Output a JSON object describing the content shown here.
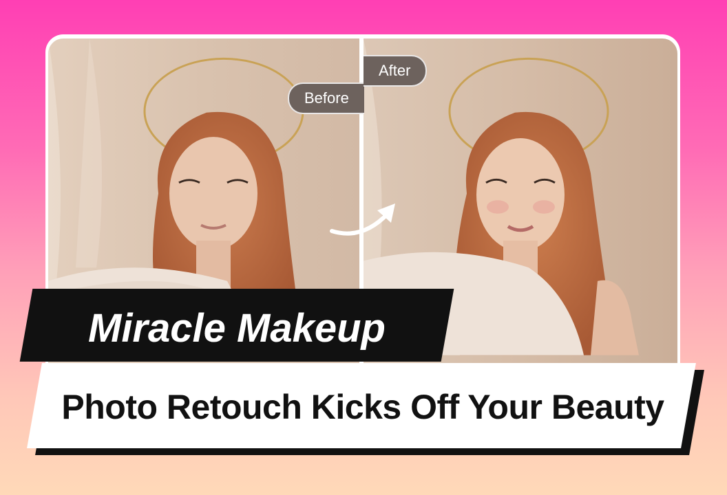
{
  "labels": {
    "before": "Before",
    "after": "After"
  },
  "headline": "Miracle Makeup",
  "subheadline": "Photo Retouch Kicks Off Your Beauty",
  "colors": {
    "pink_top": "#ff3fb4",
    "peach_bottom": "#ffd9b8",
    "tag_bg": "#6d625d",
    "banner_black": "#111111",
    "banner_white": "#ffffff"
  },
  "images": {
    "before": "portrait of red-haired woman with golden halo ring, no makeup",
    "after": "same portrait after makeup retouch"
  }
}
